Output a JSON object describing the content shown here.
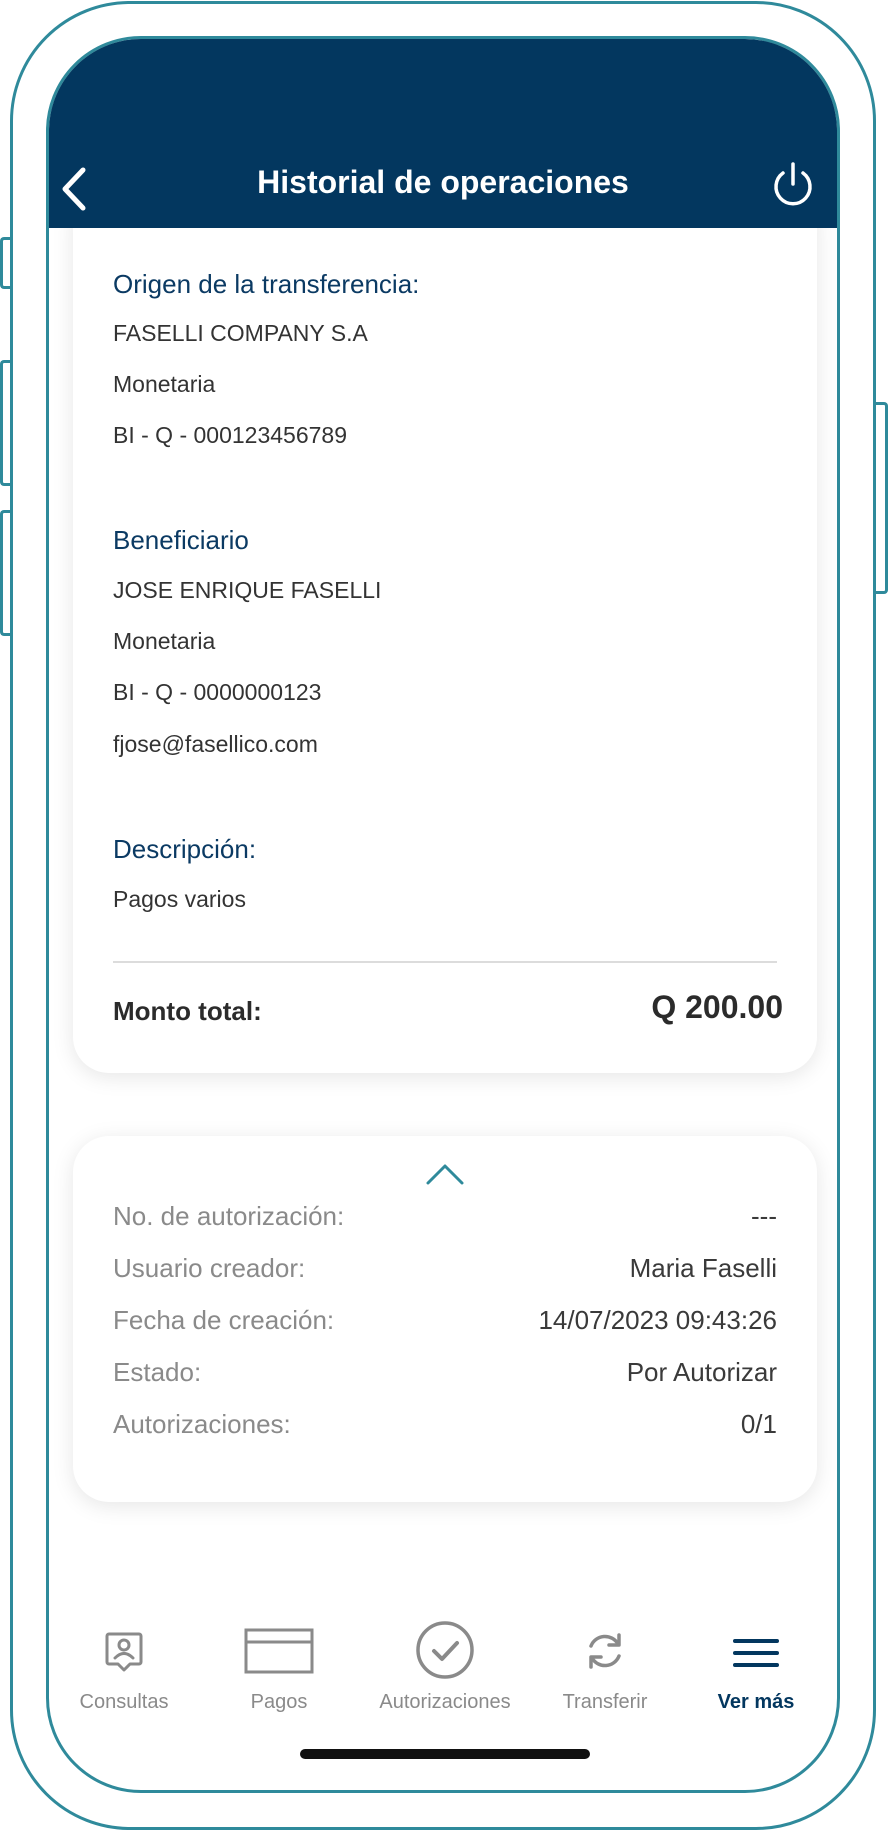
{
  "header": {
    "title": "Historial de operaciones"
  },
  "origen": {
    "label": "Origen de la transferencia:",
    "name": "FASELLI COMPANY S.A",
    "type": "Monetaria",
    "account": "BI - Q - 000123456789"
  },
  "beneficiario": {
    "label": "Beneficiario",
    "name": "JOSE ENRIQUE FASELLI",
    "type": "Monetaria",
    "account": "BI - Q - 0000000123",
    "email": "fjose@fasellico.com"
  },
  "descripcion": {
    "label": "Descripción:",
    "value": "Pagos varios"
  },
  "total": {
    "label": "Monto total:",
    "value": "Q 200.00"
  },
  "details": [
    {
      "key": "No. de autorización:",
      "value": "---"
    },
    {
      "key": "Usuario creador:",
      "value": "Maria Faselli"
    },
    {
      "key": "Fecha de creación:",
      "value": "14/07/2023 09:43:26"
    },
    {
      "key": "Estado:",
      "value": "Por Autorizar"
    },
    {
      "key": "Autorizaciones:",
      "value": "0/1"
    }
  ],
  "nav": [
    {
      "label": "Consultas",
      "icon": "profile-badge-icon"
    },
    {
      "label": "Pagos",
      "icon": "card-icon"
    },
    {
      "label": "Autorizaciones",
      "icon": "check-circle-icon"
    },
    {
      "label": "Transferir",
      "icon": "refresh-icon"
    },
    {
      "label": "Ver más",
      "icon": "menu-icon",
      "active": true
    }
  ],
  "colors": {
    "primary": "#03375f",
    "frame": "#2f8a9b"
  }
}
